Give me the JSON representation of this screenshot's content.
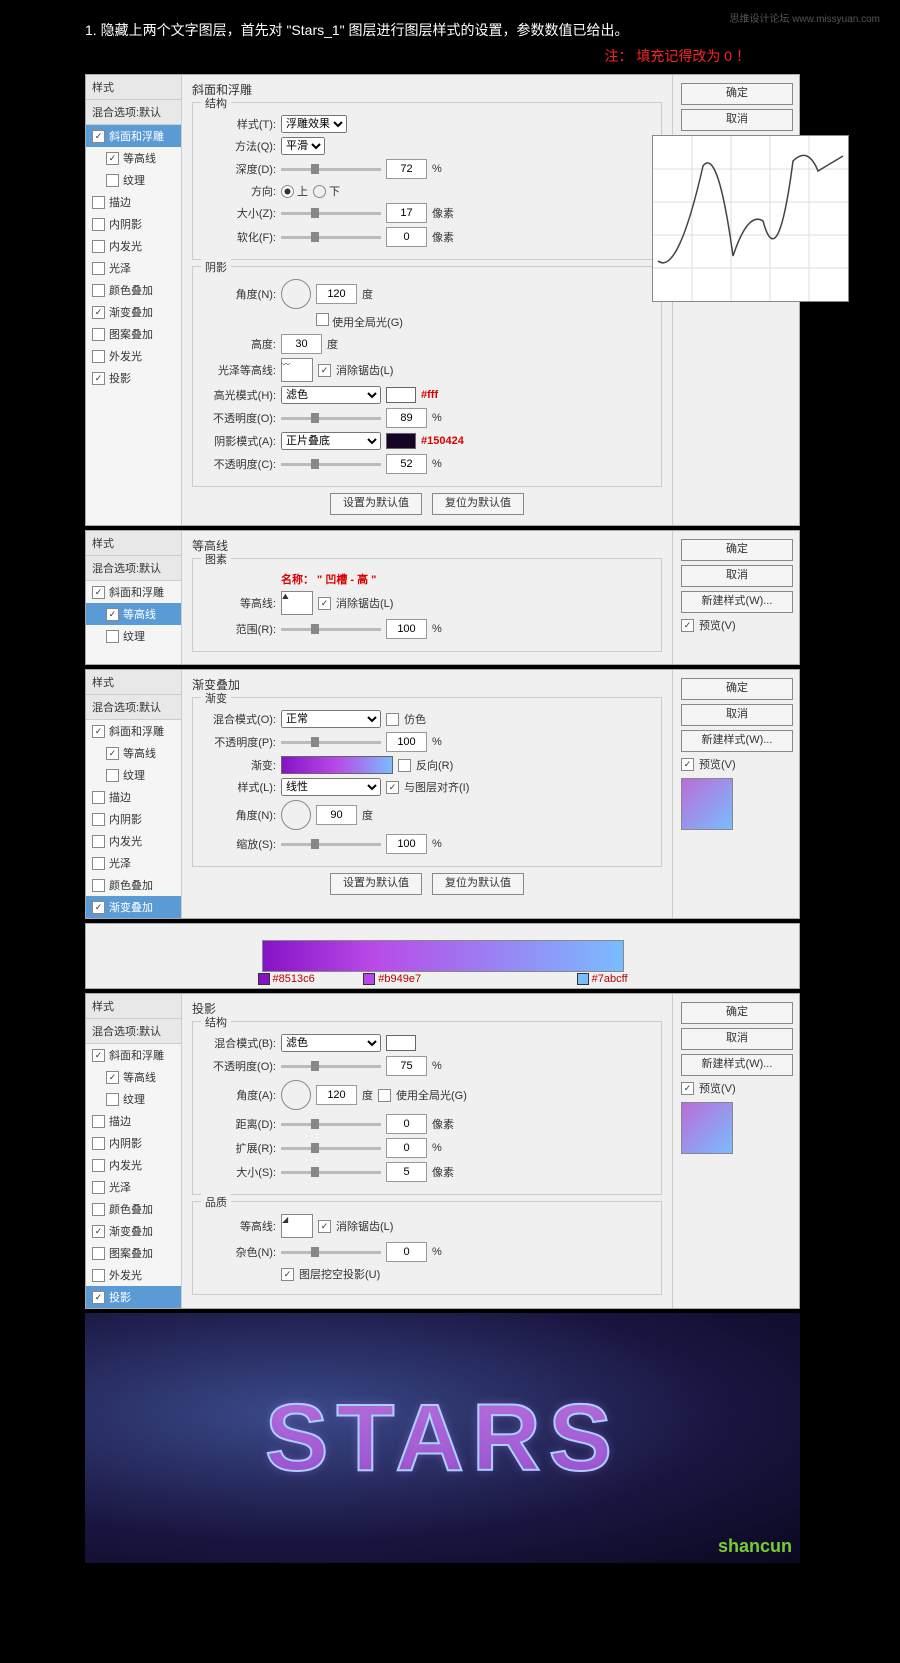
{
  "header": "1. 隐藏上两个文字图层，首先对 \"Stars_1\" 图层进行图层样式的设置，参数数值已给出。",
  "note": "注： 填充记得改为 0 ！",
  "watermark": "思维设计论坛 www.missyuan.com",
  "common": {
    "styles_hd": "样式",
    "blend": "混合选项:默认",
    "ok": "确定",
    "cancel": "取消",
    "new_style": "新建样式(W)...",
    "preview": "预览(V)",
    "reset_default": "设置为默认值",
    "restore_default": "复位为默认值"
  },
  "effects": {
    "bevel": "斜面和浮雕",
    "contour": "等高线",
    "texture": "纹理",
    "stroke": "描边",
    "inner_shadow": "内阴影",
    "inner_glow": "内发光",
    "satin": "光泽",
    "color_overlay": "颜色叠加",
    "grad_overlay": "渐变叠加",
    "pattern_overlay": "图案叠加",
    "outer_glow": "外发光",
    "drop_shadow": "投影"
  },
  "p1": {
    "title": "斜面和浮雕",
    "sect_struct": "结构",
    "sect_shadow": "阴影",
    "style_l": "样式(T):",
    "style_v": "浮雕效果",
    "method_l": "方法(Q):",
    "method_v": "平滑",
    "depth_l": "深度(D):",
    "depth_v": "72",
    "pct": "%",
    "dir_l": "方向:",
    "up": "上",
    "down": "下",
    "size_l": "大小(Z):",
    "size_v": "17",
    "px": "像素",
    "soften_l": "软化(F):",
    "soften_v": "0",
    "angle_l": "角度(N):",
    "angle_v": "120",
    "deg": "度",
    "global": "使用全局光(G)",
    "alt_l": "高度:",
    "alt_v": "30",
    "gloss_l": "光泽等高线:",
    "anti": "消除锯齿(L)",
    "hi_mode_l": "高光模式(H):",
    "hi_mode_v": "滤色",
    "hi_color": "#fff",
    "opac_l": "不透明度(O):",
    "hi_opac": "89",
    "sh_mode_l": "阴影模式(A):",
    "sh_mode_v": "正片叠底",
    "sh_color": "#150424",
    "sh_opac": "52",
    "opac2_l": "不透明度(C):"
  },
  "p2": {
    "title": "等高线",
    "sect": "图素",
    "name_note": "名称： \" 凹槽 - 高 \"",
    "contour_l": "等高线:",
    "anti": "消除锯齿(L)",
    "range_l": "范围(R):",
    "range_v": "100",
    "pct": "%"
  },
  "p3": {
    "title": "渐变叠加",
    "sect": "渐变",
    "blend_l": "混合模式(O):",
    "blend_v": "正常",
    "dither": "仿色",
    "opac_l": "不透明度(P):",
    "opac_v": "100",
    "pct": "%",
    "grad_l": "渐变:",
    "reverse": "反向(R)",
    "style_l": "样式(L):",
    "style_v": "线性",
    "align": "与图层对齐(I)",
    "angle_l": "角度(N):",
    "angle_v": "90",
    "deg": "度",
    "scale_l": "缩放(S):",
    "scale_v": "100",
    "stops": [
      "#8513c6",
      "#b949e7",
      "#7abcff"
    ]
  },
  "p4": {
    "title": "投影",
    "sect_struct": "结构",
    "sect_qual": "品质",
    "blend_l": "混合模式(B):",
    "blend_v": "滤色",
    "opac_l": "不透明度(O):",
    "opac_v": "75",
    "pct": "%",
    "angle_l": "角度(A):",
    "angle_v": "120",
    "deg": "度",
    "global": "使用全局光(G)",
    "dist_l": "距离(D):",
    "dist_v": "0",
    "px": "像素",
    "spread_l": "扩展(R):",
    "spread_v": "0",
    "size_l": "大小(S):",
    "size_v": "5",
    "contour_l": "等高线:",
    "anti": "消除锯齿(L)",
    "noise_l": "杂色(N):",
    "noise_v": "0",
    "knockout": "图层挖空投影(U)"
  },
  "stars_text": "STARS",
  "logo": "shancun",
  "chart_data": {
    "type": "line",
    "title": "gloss contour curve",
    "xlim": [
      0,
      255
    ],
    "ylim": [
      0,
      255
    ],
    "x": [
      0,
      30,
      70,
      105,
      130,
      165,
      185,
      215,
      255
    ],
    "values": [
      60,
      40,
      200,
      65,
      150,
      40,
      215,
      200,
      230
    ]
  }
}
